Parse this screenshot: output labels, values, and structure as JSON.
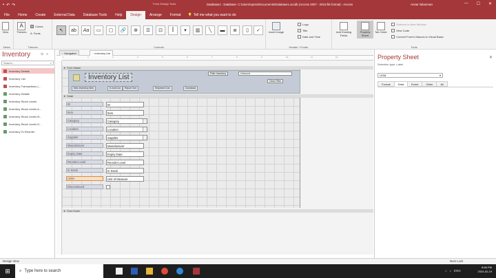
{
  "window": {
    "context_tab_group": "Form Design Tools",
    "title": "Database1 : Database- C:\\Users\\opnsn\\Documents\\Database1.accdb (Access 2007 - 2016 file format) - Access",
    "user": "Ansar Nilanman",
    "controls": [
      "—",
      "☐",
      "✕"
    ]
  },
  "tabs": [
    "File",
    "Home",
    "Create",
    "External Data",
    "Database Tools",
    "Help",
    "Design",
    "Arrange",
    "Format"
  ],
  "active_tab": "Design",
  "tell_me": "Tell me what you want to do",
  "ribbon": {
    "groups": {
      "views": "Views",
      "themes": "Themes",
      "controls": "Controls",
      "header_footer": "Header / Footer",
      "tools": "Tools"
    },
    "view_label": "View",
    "themes_label": "Themes",
    "colors_label": "Colors",
    "fonts_label": "Fonts",
    "insert_image_label": "Insert Image",
    "logo_label": "Logo",
    "title_label": "Title",
    "date_time_label": "Date and Time",
    "add_existing_fields": "Add Existing Fields",
    "property_sheet": "Property Sheet",
    "tab_order": "Tab Order",
    "subform_new_window": "Subform in New Window",
    "view_code": "View Code",
    "convert_macros": "Convert Form's Macros to Visual Basic"
  },
  "nav": {
    "title": "Inventory",
    "search_placeholder": "Search...",
    "items": [
      {
        "label": "Inventory Details",
        "type": "form",
        "selected": true
      },
      {
        "label": "Inventory List",
        "type": "form",
        "selected": false
      },
      {
        "label": "Inventory Transactions (...",
        "type": "form",
        "selected": false
      },
      {
        "label": "Inventory Details",
        "type": "table",
        "selected": false
      },
      {
        "label": "Inventory Stock Levels",
        "type": "table",
        "selected": false
      },
      {
        "label": "Inventory Stock Levels A...",
        "type": "table",
        "selected": false
      },
      {
        "label": "Inventory Stock Levels B...",
        "type": "table",
        "selected": false
      },
      {
        "label": "Inventory Stock Levels D...",
        "type": "table",
        "selected": false
      },
      {
        "label": "Inventory To Reorder",
        "type": "table",
        "selected": false
      }
    ]
  },
  "doc_tabs": [
    "Navigation",
    "Inventory List"
  ],
  "active_doc_tab": "Inventory List",
  "design": {
    "form_header_label": "Form Header",
    "detail_label": "Detail",
    "form_footer_label": "Form Footer",
    "form_title": "Inventory List",
    "filter_label": "Filter Inventory",
    "unbound": "Unbound",
    "clear_filter": "Clear Filter",
    "header_buttons": [
      "New Inventory Item",
      "E-mail List",
      "Report Sort",
      "Shipment Due"
    ],
    "header_button_extra": "Download",
    "fields": [
      {
        "label": "ID",
        "control": "ID",
        "combo": false
      },
      {
        "label": "Item",
        "control": "Item",
        "combo": false
      },
      {
        "label": "Category",
        "control": "Category",
        "combo": true
      },
      {
        "label": "Location",
        "control": "Location",
        "combo": true
      },
      {
        "label": "Supplier",
        "control": "Supplier",
        "combo": true
      },
      {
        "label": "Manufacturer",
        "control": "Manufacturer",
        "combo": false
      },
      {
        "label": "Expiry Date",
        "control": "Expiry Date",
        "combo": false
      },
      {
        "label": "Reorder Level",
        "control": "Reorder Level",
        "combo": false
      },
      {
        "label": "In Stock",
        "control": "In Stock",
        "combo": false
      },
      {
        "label": "UOM",
        "control": "Unit of Measure",
        "combo": false
      },
      {
        "label": "Discontinued",
        "control": "",
        "combo": false
      }
    ],
    "ruler_marks": [
      "1",
      "2",
      "3",
      "4",
      "5",
      "6",
      "7",
      "8",
      "9",
      "10",
      "11",
      "12"
    ]
  },
  "property_sheet": {
    "title": "Property Sheet",
    "selection_type": "Selection type: Label",
    "selected": "UOM",
    "tabs": [
      "Format",
      "Data",
      "Event",
      "Other",
      "All"
    ],
    "active_tab": "Data"
  },
  "status": {
    "left": "Design View",
    "right": "Num Lock"
  },
  "taskbar": {
    "search_placeholder": "Type here to search",
    "time": "8:56 PM",
    "date": "2024-02-19",
    "lang": "ENG"
  },
  "colors": {
    "accent": "#a4373a"
  }
}
